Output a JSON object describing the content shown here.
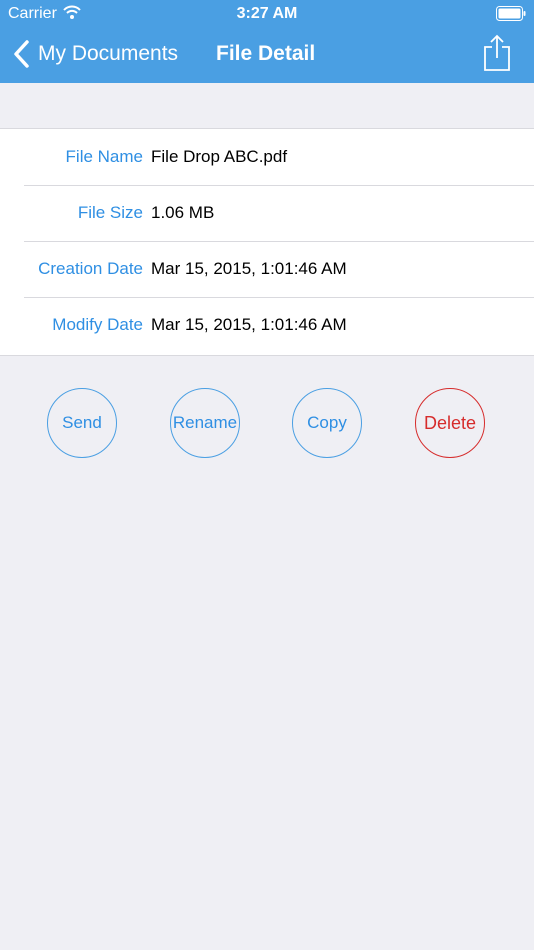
{
  "status_bar": {
    "carrier": "Carrier",
    "time": "3:27 AM",
    "wifi_icon": "wifi-icon",
    "battery_icon": "battery-icon"
  },
  "nav_bar": {
    "back_label": "My Documents",
    "title": "File Detail",
    "back_icon": "chevron-left-icon",
    "share_icon": "share-icon"
  },
  "details": [
    {
      "label": "File Name",
      "value": "File Drop ABC.pdf"
    },
    {
      "label": "File Size",
      "value": "1.06 MB"
    },
    {
      "label": "Creation Date",
      "value": "Mar 15, 2015, 1:01:46 AM"
    },
    {
      "label": "Modify Date",
      "value": "Mar 15, 2015, 1:01:46 AM"
    }
  ],
  "actions": {
    "send": "Send",
    "rename": "Rename",
    "copy": "Copy",
    "delete": "Delete"
  },
  "colors": {
    "nav_background": "#4a9fe3",
    "label_blue": "#2f8fe3",
    "delete_red": "#d62c2c",
    "page_background": "#efeff4"
  }
}
